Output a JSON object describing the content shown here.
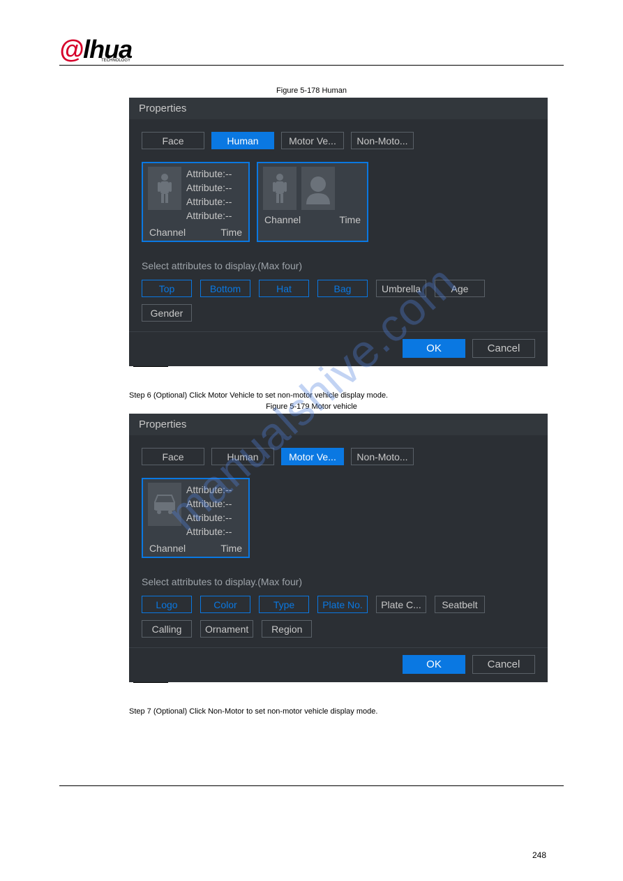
{
  "logo": {
    "a": "@",
    "rest": "lhua",
    "sub": "TECHNOLOGY"
  },
  "figure1": {
    "label": "Figure 5-178 Human",
    "title": "Properties"
  },
  "figure2": {
    "label": "Figure 5-179 Motor vehicle",
    "title": "Properties"
  },
  "steps": {
    "s1": "Step 6 (Optional) Click Motor Vehicle to set non-motor vehicle display mode.",
    "s2": "Step 7 (Optional) Click Non-Motor to set non-motor vehicle display mode."
  },
  "tabs": {
    "face": "Face",
    "human": "Human",
    "motor": "Motor Ve...",
    "nonmotor": "Non-Moto..."
  },
  "card": {
    "attr": "Attribute:--",
    "channel": "Channel",
    "time": "Time"
  },
  "instr": "Select attributes to display.(Max four)",
  "attrs1": {
    "top": "Top",
    "bottom": "Bottom",
    "hat": "Hat",
    "bag": "Bag",
    "umbrella": "Umbrella",
    "age": "Age",
    "gender": "Gender"
  },
  "attrs2": {
    "logo": "Logo",
    "color": "Color",
    "type": "Type",
    "plateno": "Plate No.",
    "platec": "Plate C...",
    "seatbelt": "Seatbelt",
    "calling": "Calling",
    "ornament": "Ornament",
    "region": "Region"
  },
  "footer": {
    "ok": "OK",
    "cancel": "Cancel"
  },
  "watermark": "manualshive.com",
  "pagenum": "248"
}
